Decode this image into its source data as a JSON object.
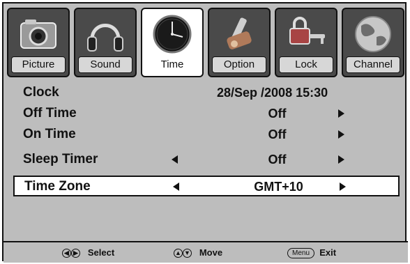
{
  "tabs": [
    {
      "label": "Picture",
      "icon": "camera-icon"
    },
    {
      "label": "Sound",
      "icon": "headphones-icon"
    },
    {
      "label": "Time",
      "icon": "clock-icon",
      "active": true
    },
    {
      "label": "Option",
      "icon": "tools-icon"
    },
    {
      "label": "Lock",
      "icon": "lock-icon"
    },
    {
      "label": "Channel",
      "icon": "globe-icon"
    }
  ],
  "menu": {
    "clock": {
      "label": "Clock",
      "value": "28/Sep  /2008 15:30"
    },
    "off_time": {
      "label": "Off Time",
      "value": "Off"
    },
    "on_time": {
      "label": "On Time",
      "value": "Off"
    },
    "sleep_timer": {
      "label": "Sleep Timer",
      "value": "Off"
    },
    "time_zone": {
      "label": "Time Zone",
      "value": "GMT+10",
      "selected": true
    }
  },
  "footer": {
    "select_label": "Select",
    "move_label": "Move",
    "menu_key": "Menu",
    "exit_label": "Exit"
  }
}
